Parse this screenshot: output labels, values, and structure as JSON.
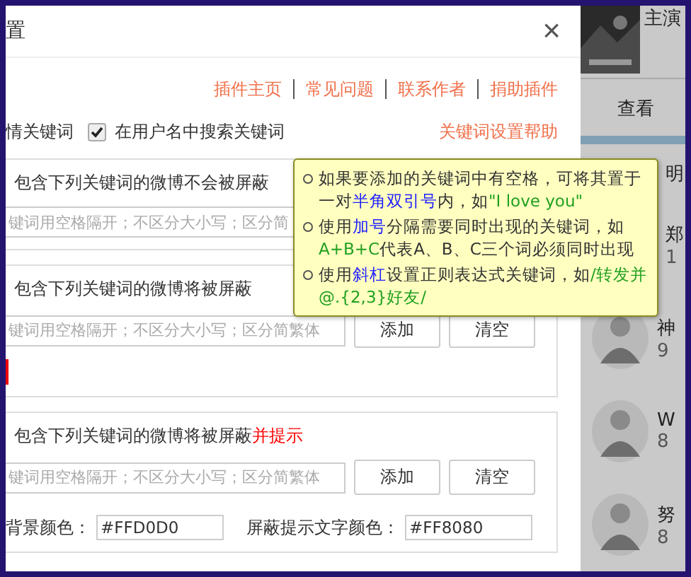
{
  "dialog": {
    "title": "置",
    "close": "×",
    "links": [
      "插件主页",
      "常见问题",
      "联系作者",
      "捐助插件"
    ],
    "options": [
      {
        "kind": "text",
        "label": "情关键词"
      },
      {
        "kind": "checkbox",
        "label": "在用户名中搜索关键词",
        "checked": true
      }
    ],
    "help_link": "关键词设置帮助",
    "sections": [
      {
        "title": [
          {
            "text": "包含下列关键词的微博不会被屏蔽"
          }
        ],
        "placeholder": "键词用空格隔开；不区分大小写；区分简"
      },
      {
        "title": [
          {
            "text": "包含下列关键词的微博将被屏蔽"
          }
        ],
        "placeholder": "键词用空格隔开；不区分大小写；区分简繁体",
        "buttons": [
          "添加",
          "清空"
        ],
        "marker": true
      },
      {
        "title": [
          {
            "text": "包含下列关键词的微博将被屏蔽"
          },
          {
            "text": "并提示",
            "color": "#ff0000"
          }
        ],
        "placeholder": "键词用空格隔开；不区分大小写；区分简繁体",
        "buttons": [
          "添加",
          "清空"
        ]
      }
    ],
    "color_fields": [
      {
        "label": "背景颜色：",
        "value": "#FFD0D0"
      },
      {
        "label": "屏蔽提示文字颜色：",
        "value": "#FF8080"
      }
    ]
  },
  "tooltip": {
    "items": [
      [
        {
          "text": "如果要添加的关键词中有空格，可将其置于一对"
        },
        {
          "text": "半角双引号",
          "color": "#2020ff"
        },
        {
          "text": "内，如"
        },
        {
          "text": "\"I love you\"",
          "color": "#20a020"
        }
      ],
      [
        {
          "text": "使用"
        },
        {
          "text": "加号",
          "color": "#2020ff"
        },
        {
          "text": "分隔需要同时出现的关键词，如"
        },
        {
          "text": "A+B+C",
          "color": "#20a020"
        },
        {
          "text": "代表A、B、C三个词必须同时出现"
        }
      ],
      [
        {
          "text": "使用"
        },
        {
          "text": "斜杠",
          "color": "#2020ff"
        },
        {
          "text": "设置正则表达式关键词，如"
        },
        {
          "text": "/转发并@.{2,3}好友/",
          "color": "#20a020"
        }
      ]
    ]
  },
  "sidebar": {
    "top_label": "主演",
    "link": "查看",
    "heading": "明",
    "entries": [
      {
        "avatar": false,
        "name": "郑",
        "count": "1"
      },
      {
        "avatar": true,
        "name": "神",
        "count": "9"
      },
      {
        "avatar": true,
        "name": "W",
        "count": "8"
      },
      {
        "avatar": true,
        "name": "努",
        "count": "8"
      }
    ]
  }
}
